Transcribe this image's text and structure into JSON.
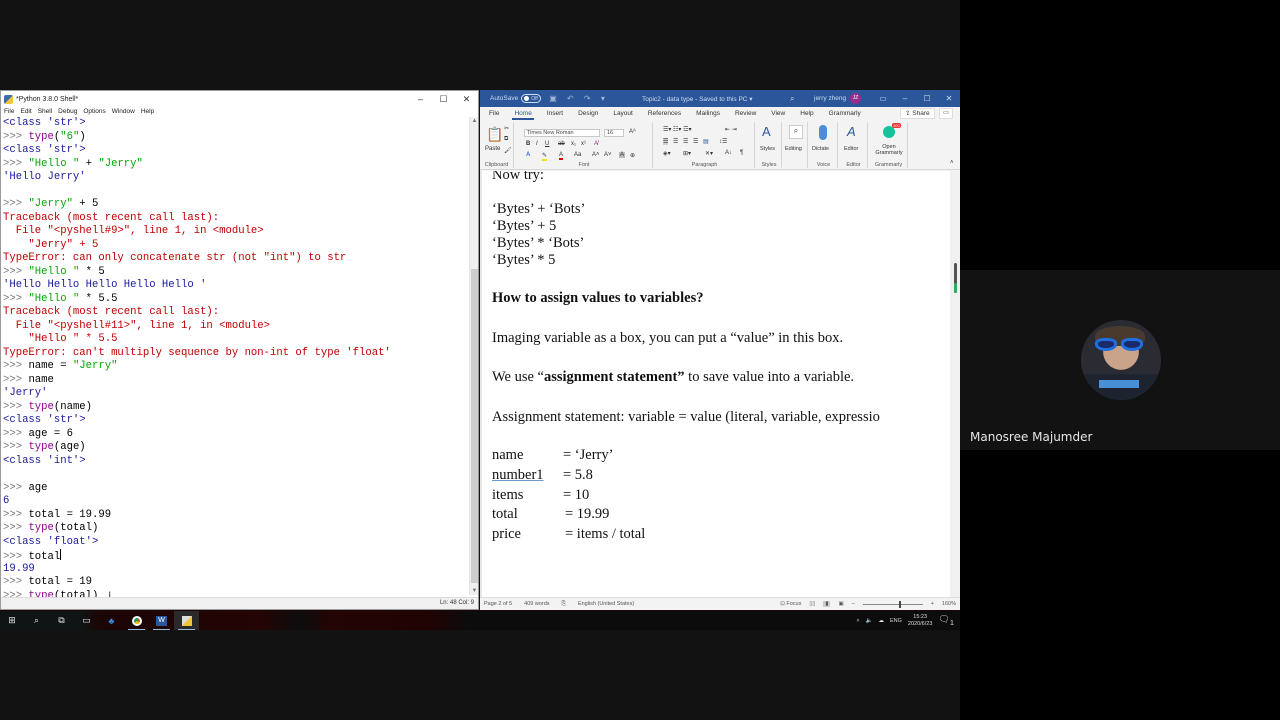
{
  "idle": {
    "title": "*Python 3.8.0 Shell*",
    "menu": [
      "File",
      "Edit",
      "Shell",
      "Debug",
      "Options",
      "Window",
      "Help"
    ],
    "window_controls": [
      "–",
      "☐",
      "✕"
    ],
    "lines": [
      [
        [
          "out",
          "<class 'str'>"
        ]
      ],
      [
        [
          "prompt",
          ">>> "
        ],
        [
          "builtin",
          "type"
        ],
        [
          "code",
          "("
        ],
        [
          "str",
          "\"6\""
        ],
        [
          "code",
          ")"
        ]
      ],
      [
        [
          "out",
          "<class 'str'>"
        ]
      ],
      [
        [
          "prompt",
          ">>> "
        ],
        [
          "str",
          "\"Hello \""
        ],
        [
          "code",
          " + "
        ],
        [
          "str",
          "\"Jerry\""
        ]
      ],
      [
        [
          "out",
          "'Hello Jerry'"
        ]
      ],
      [],
      [
        [
          "prompt",
          ">>> "
        ],
        [
          "str",
          "\"Jerry\""
        ],
        [
          "code",
          " + 5"
        ]
      ],
      [
        [
          "err",
          "Traceback (most recent call last):"
        ]
      ],
      [
        [
          "err",
          "  File \"<pyshell#9>\", line 1, in <module>"
        ]
      ],
      [
        [
          "err",
          "    \"Jerry\" + 5"
        ]
      ],
      [
        [
          "err",
          "TypeError: can only concatenate str (not \"int\") to str"
        ]
      ],
      [
        [
          "prompt",
          ">>> "
        ],
        [
          "str",
          "\"Hello \""
        ],
        [
          "code",
          " * 5"
        ]
      ],
      [
        [
          "out",
          "'Hello Hello Hello Hello Hello '"
        ]
      ],
      [
        [
          "prompt",
          ">>> "
        ],
        [
          "str",
          "\"Hello \""
        ],
        [
          "code",
          " * 5.5"
        ]
      ],
      [
        [
          "err",
          "Traceback (most recent call last):"
        ]
      ],
      [
        [
          "err",
          "  File \"<pyshell#11>\", line 1, in <module>"
        ]
      ],
      [
        [
          "err",
          "    \"Hello \" * 5.5"
        ]
      ],
      [
        [
          "err",
          "TypeError: can't multiply sequence by non-int of type 'float'"
        ]
      ],
      [
        [
          "prompt",
          ">>> "
        ],
        [
          "code",
          "name = "
        ],
        [
          "str",
          "\"Jerry\""
        ]
      ],
      [
        [
          "prompt",
          ">>> "
        ],
        [
          "code",
          "name"
        ]
      ],
      [
        [
          "out",
          "'Jerry'"
        ]
      ],
      [
        [
          "prompt",
          ">>> "
        ],
        [
          "builtin",
          "type"
        ],
        [
          "code",
          "(name)"
        ]
      ],
      [
        [
          "out",
          "<class 'str'>"
        ]
      ],
      [
        [
          "prompt",
          ">>> "
        ],
        [
          "code",
          "age = 6"
        ]
      ],
      [
        [
          "prompt",
          ">>> "
        ],
        [
          "builtin",
          "type"
        ],
        [
          "code",
          "(age)"
        ]
      ],
      [
        [
          "out",
          "<class 'int'>"
        ]
      ],
      [],
      [
        [
          "prompt",
          ">>> "
        ],
        [
          "code",
          "age"
        ]
      ],
      [
        [
          "out",
          "6"
        ]
      ],
      [
        [
          "prompt",
          ">>> "
        ],
        [
          "code",
          "total = 19.99"
        ]
      ],
      [
        [
          "prompt",
          ">>> "
        ],
        [
          "builtin",
          "type"
        ],
        [
          "code",
          "(total)"
        ]
      ],
      [
        [
          "out",
          "<class 'float'>"
        ]
      ],
      [
        [
          "prompt",
          ">>> "
        ],
        [
          "code",
          "total"
        ],
        [
          "caret",
          ""
        ]
      ],
      [
        [
          "out",
          "19.99"
        ]
      ],
      [
        [
          "prompt",
          ">>> "
        ],
        [
          "code",
          "total = 19"
        ]
      ],
      [
        [
          "prompt",
          ">>> "
        ],
        [
          "builtin",
          "type"
        ],
        [
          "code",
          "(total)"
        ],
        [
          "ibeam",
          "I"
        ]
      ]
    ],
    "status": "Ln: 48  Col: 9"
  },
  "word": {
    "autosave_label": "AutoSave",
    "autosave_state": "Off",
    "doc_title": "Topic2 - data type  -  Saved to this PC  ▾",
    "user_name": "jerry zheng",
    "user_initials": "JZ",
    "tabs": [
      "File",
      "Home",
      "Insert",
      "Design",
      "Layout",
      "References",
      "Mailings",
      "Review",
      "View",
      "Help",
      "Grammarly"
    ],
    "active_tab": "Home",
    "share_label": "Share",
    "ribbon": {
      "paste_label": "Paste",
      "font_name": "Times New Roman",
      "font_size": "16",
      "group_labels": [
        "Clipboard",
        "Font",
        "Paragraph",
        "Styles",
        "Voice",
        "Editor",
        "Grammarly"
      ],
      "styles_label": "Styles",
      "editing_label": "Editing",
      "dictate_label": "Dictate",
      "editor_label": "Editor",
      "grammarly_label": "Open Grammarly",
      "grammarly_badge": "100"
    },
    "document": {
      "now_try": "Now try:",
      "tries": [
        "‘Bytes’ + ‘Bots’",
        "‘Bytes’ + 5",
        "‘Bytes’ * ‘Bots’",
        "‘Bytes’ * 5"
      ],
      "heading": "How to assign values to variables?",
      "para1": "Imaging variable as a box, you can put a “value” in this box.",
      "para2_pre": "We use “",
      "para2_bold": "assignment statement”",
      "para2_post": " to save value into a variable.",
      "para3": "Assignment statement: variable = value (literal, variable, expressio",
      "assignments": [
        {
          "var": "name",
          "value": "= ‘Jerry’"
        },
        {
          "var": "number1",
          "value": "= 5.8"
        },
        {
          "var": "items",
          "value": "= 10"
        },
        {
          "var": "total",
          "value": "= 19.99"
        },
        {
          "var": "price",
          "value": "= items / total"
        }
      ]
    },
    "status": {
      "page": "Page 2 of 5",
      "words": "409 words",
      "language": "English (United States)",
      "focus": "Focus",
      "zoom": "160%",
      "zoom_fraction": 0.6
    }
  },
  "meeting": {
    "participant_name": "Manosree Majumder"
  },
  "taskbar": {
    "icons": [
      "windows-start",
      "search",
      "task-view",
      "terminal",
      "app",
      "chrome",
      "word",
      "python-idle"
    ],
    "tray_lang": "ENG",
    "time": "15:23",
    "date": "2020/6/23",
    "notification_count": "1"
  }
}
